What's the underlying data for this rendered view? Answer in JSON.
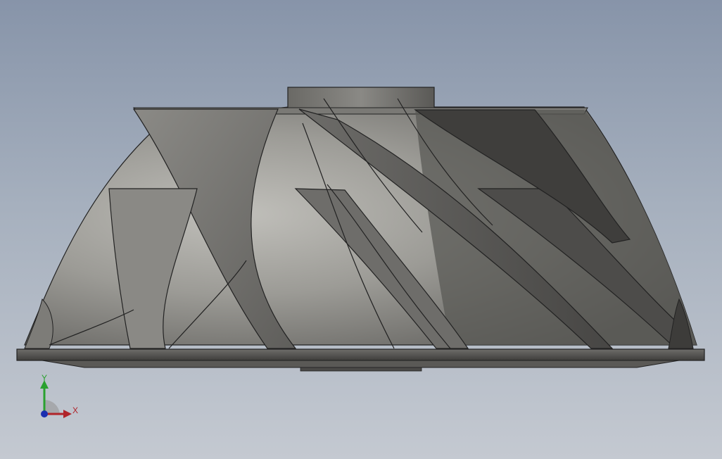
{
  "viewport": {
    "background_top": "#8794a9",
    "background_bottom": "#c4c9d1"
  },
  "model": {
    "name": "impeller-model",
    "blade_count_visible": 8,
    "colors": {
      "hub_light": "#b3b2ad",
      "hub_mid": "#8f8e8a",
      "hub_dark": "#5e5d5a",
      "blade_face": "#737270",
      "blade_dark": "#4e4d4b",
      "edge": "#222222"
    }
  },
  "triad": {
    "x_label": "X",
    "y_label": "Y",
    "x_color": "#b0242a",
    "y_color": "#2aa12f",
    "z_color": "#1b2fb0"
  }
}
